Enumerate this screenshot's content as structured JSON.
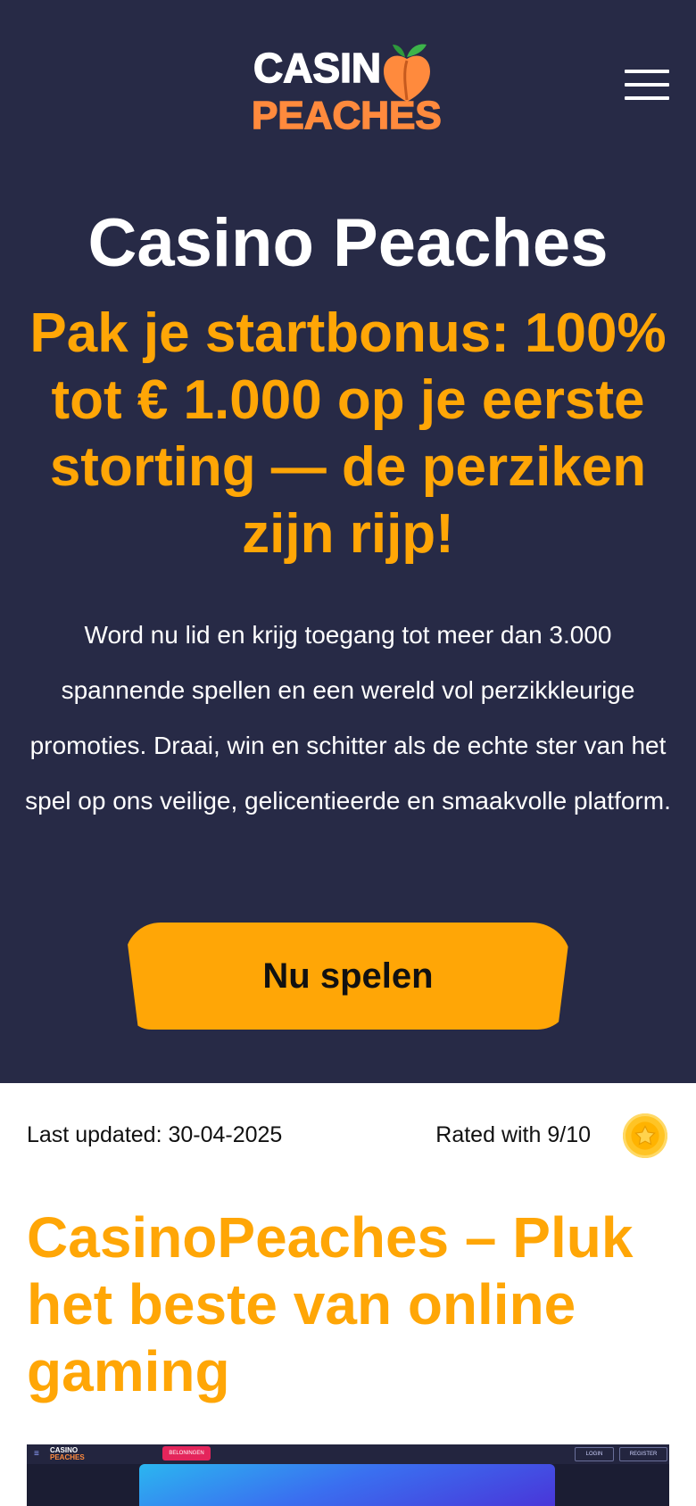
{
  "brand": {
    "logo_line1": "CASIN",
    "logo_line2": "PEACHES",
    "colors": {
      "background": "#272a46",
      "accent": "#ffa606",
      "logo_orange": "#ff8a3d",
      "leaf_green": "#3cb44a"
    }
  },
  "header": {
    "menu_icon": "hamburger-menu-icon"
  },
  "hero": {
    "title": "Casino Peaches",
    "subtitle": "Pak je startbonus: 100% tot € 1.000 op je eerste storting — de perziken zijn rijp!",
    "text": "Word nu lid en krijg toegang tot meer dan 3.000 spannende spellen en een wereld vol perzikkleurige promoties. Draai, win en schitter als de echte ster van het spel op ons veilige, gelicentieerde en smaakvolle platform.",
    "cta_label": "Nu spelen"
  },
  "meta": {
    "last_updated": "Last updated: 30-04-2025",
    "rating": "Rated with 9/10",
    "rating_icon": "star-icon"
  },
  "article": {
    "title": "CasinoPeaches – Pluk het beste van online gaming"
  },
  "screenshot_preview": {
    "menu_icon": "≡",
    "logo_top": "CASINO",
    "logo_bottom": "PEACHES",
    "rewards_label": "BELONINGEN",
    "login_label": "LOGIN",
    "register_label": "REGISTER"
  }
}
